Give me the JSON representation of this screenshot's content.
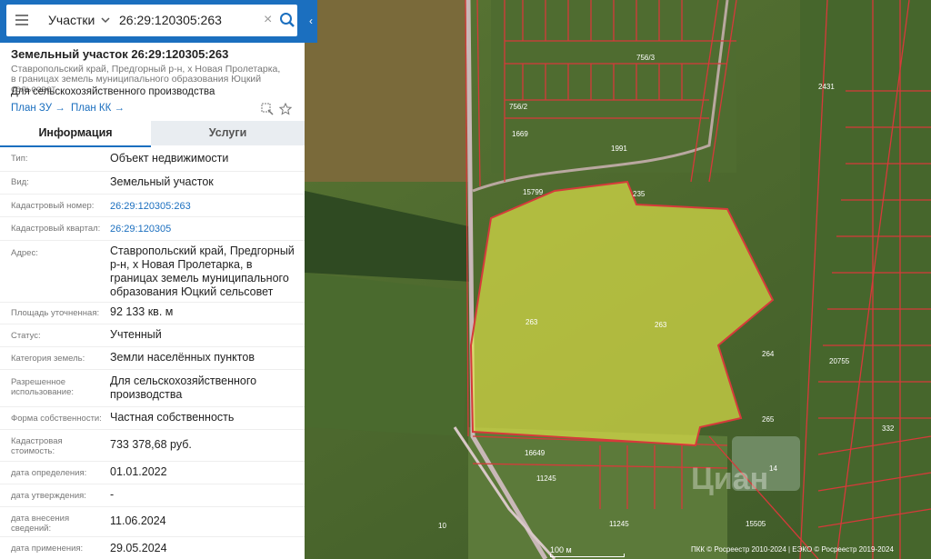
{
  "search": {
    "category": "Участки",
    "value": "26:29:120305:263"
  },
  "card": {
    "title": "Земельный участок 26:29:120305:263",
    "address_sub": "Ставропольский край, Предгорный р-н, х Новая Пролетарка, в границах земель муниципального образования Юцкий сельсовет",
    "purpose": "Для сельскохозяйственного производства",
    "link_zu": "План ЗУ",
    "link_kk": "План КК",
    "arrow": "→"
  },
  "tabs": [
    "Информация",
    "Услуги"
  ],
  "info": [
    {
      "label": "Тип:",
      "value": "Объект недвижимости"
    },
    {
      "label": "Вид:",
      "value": "Земельный участок"
    },
    {
      "label": "Кадастровый номер:",
      "value": "26:29:120305:263"
    },
    {
      "label": "Кадастровый квартал:",
      "value": "26:29:120305"
    },
    {
      "label": "Адрес:",
      "value": "Ставропольский край, Предгорный р-н, х Новая Пролетарка, в границах земель муниципального образования Юцкий сельсовет"
    },
    {
      "label": "Площадь уточненная:",
      "value": "92 133 кв. м"
    },
    {
      "label": "Статус:",
      "value": "Учтенный"
    },
    {
      "label": "Категория земель:",
      "value": "Земли населённых пунктов"
    },
    {
      "label": "Разрешенное использование:",
      "value": "Для сельскохозяйственного производства"
    },
    {
      "label": "Форма собственности:",
      "value": "Частная собственность"
    },
    {
      "label": "Кадастровая стоимость:",
      "value": "733 378,68 руб."
    },
    {
      "label": "дата определения:",
      "value": "01.01.2022"
    },
    {
      "label": "дата утверждения:",
      "value": "-"
    },
    {
      "label": "дата внесения сведений:",
      "value": "11.06.2024"
    },
    {
      "label": "дата применения:",
      "value": "29.05.2024"
    }
  ],
  "map": {
    "parcel_labels": [
      "263",
      "263",
      "264",
      "265",
      "235",
      "15799",
      "1991",
      "1669",
      "16649",
      "11245",
      "11245",
      "15505",
      "2431",
      "20755",
      "332",
      "756/3",
      "756/2",
      "14",
      "10"
    ],
    "scale": "100 м",
    "copyright": "ПКК © Росреестр 2010-2024 | ЕЭКО © Росреестр 2019-2024",
    "watermark": "Циан",
    "highlight_color": "#e6e84a"
  }
}
